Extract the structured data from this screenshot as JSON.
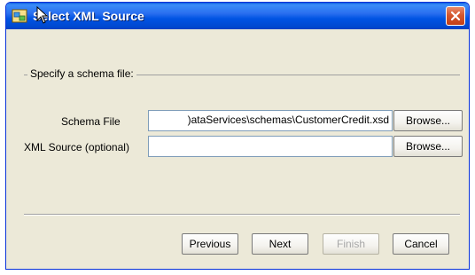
{
  "window": {
    "title": "Select XML Source"
  },
  "group": {
    "legend": "Specify a schema file:"
  },
  "fields": {
    "schema_file_label": "Schema File",
    "schema_file_value": ")ataServices\\schemas\\CustomerCredit.xsd",
    "xml_source_label": "XML Source (optional)",
    "xml_source_value": ""
  },
  "buttons": {
    "browse_schema": "Browse...",
    "browse_xml": "Browse...",
    "previous": "Previous",
    "next": "Next",
    "finish": "Finish",
    "cancel": "Cancel"
  },
  "icons": {
    "window_icon": "xml-source-icon",
    "close": "close-icon",
    "cursor": "mouse-pointer-icon"
  }
}
